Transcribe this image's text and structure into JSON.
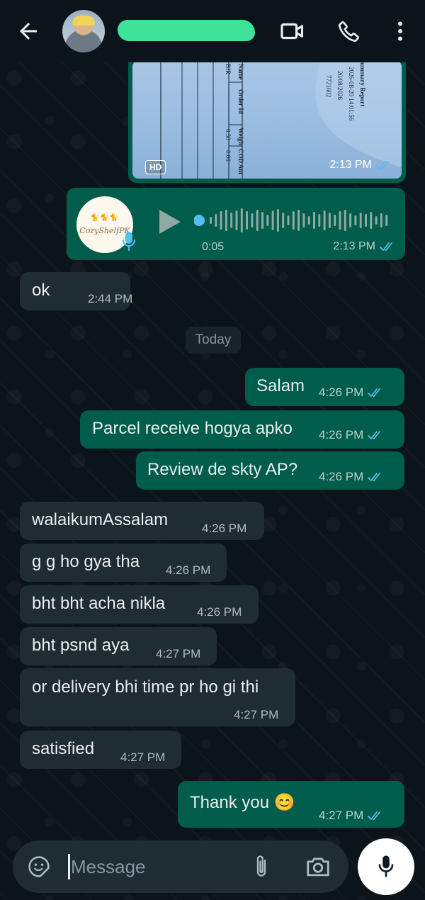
{
  "header": {
    "back_icon": "arrow-left-icon",
    "contact_name": "",
    "video_icon": "video-camera-icon",
    "call_icon": "phone-icon",
    "menu_icon": "more-vertical-icon"
  },
  "image_message": {
    "badge": "HD",
    "time": "2:13 PM",
    "doc_text": {
      "title": "ummary Report",
      "datetime": "2026-08-20 14:01:56",
      "date": "20/08/2026",
      "id": "7721602",
      "col_name": "Name",
      "col_order": "Order Id",
      "col_weight": "Weight",
      "col_cod": "COD Am",
      "row_name": "BIR",
      "row_weight": "0.50",
      "row_cod": "0.00"
    }
  },
  "voice_message": {
    "avatar_brand": "CozyShelfPK",
    "duration": "0:05",
    "time": "2:13 PM"
  },
  "messages": [
    {
      "dir": "in",
      "text": "ok",
      "time": "2:44 PM"
    },
    {
      "dir": "out",
      "text": "Salam",
      "time": "4:26 PM"
    },
    {
      "dir": "out",
      "text": "Parcel receive hogya apko",
      "time": "4:26 PM"
    },
    {
      "dir": "out",
      "text": "Review de skty AP?",
      "time": "4:26 PM"
    },
    {
      "dir": "in",
      "text": "walaikumAssalam",
      "time": "4:26 PM"
    },
    {
      "dir": "in",
      "text": "g g ho gya tha",
      "time": "4:26 PM"
    },
    {
      "dir": "in",
      "text": "bht bht acha nikla",
      "time": "4:26 PM"
    },
    {
      "dir": "in",
      "text": "bht psnd aya",
      "time": "4:27 PM"
    },
    {
      "dir": "in",
      "text": "or delivery bhi time pr ho gi thi",
      "time": "4:27 PM"
    },
    {
      "dir": "in",
      "text": "satisfied",
      "time": "4:27 PM"
    },
    {
      "dir": "out",
      "text": "Thank you 😊",
      "time": "4:27 PM"
    }
  ],
  "date_divider": "Today",
  "composer": {
    "placeholder": "Message",
    "emoji_icon": "sticker-icon",
    "attach_icon": "paperclip-icon",
    "camera_icon": "camera-icon",
    "mic_icon": "microphone-icon"
  },
  "colors": {
    "background": "#0b141a",
    "incoming_bubble": "#202c33",
    "outgoing_bubble": "#005c4b",
    "read_ticks": "#53bdeb"
  }
}
